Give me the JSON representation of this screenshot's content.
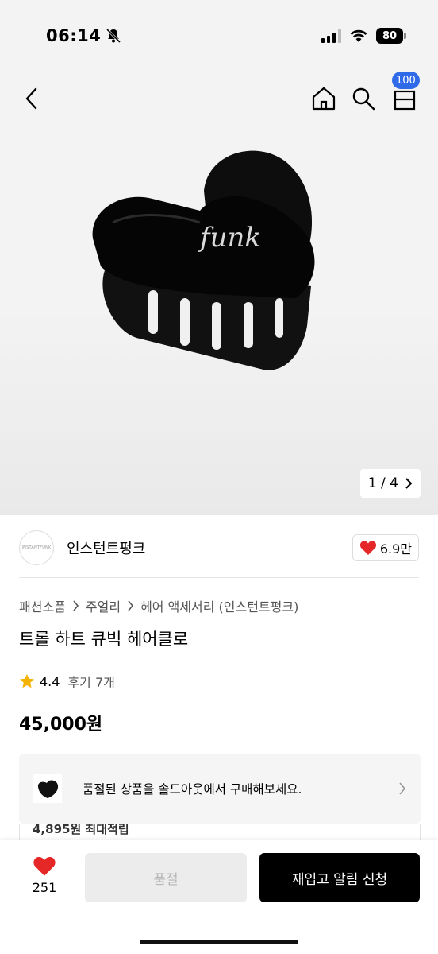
{
  "status_bar": {
    "time": "06:14",
    "battery": "80"
  },
  "nav": {
    "cart_count": "100"
  },
  "image": {
    "page": "1 / 4",
    "engraving": "funk"
  },
  "brand": {
    "name": "인스턴트펑크",
    "logo_text": "INSTANTFUNK",
    "likes": "6.9만"
  },
  "breadcrumb": [
    "패션소품",
    "주얼리",
    "헤어 액세서리 (인스턴트펑크)"
  ],
  "product": {
    "title": "트롤 하트 큐빅 헤어클로",
    "rating": "4.4",
    "review_link": "후기 7개",
    "price": "45,000원"
  },
  "soldout_banner": {
    "text": "품절된 상품을 솔드아웃에서 구매해보세요."
  },
  "points_peek": "4,895원 최대적립",
  "bottom_bar": {
    "like_count": "251",
    "soldout_label": "품절",
    "restock_label": "재입고 알림 신청"
  },
  "colors": {
    "badge_blue": "#2f6ae8",
    "heart_red": "#e62727",
    "star_yellow": "#f5b301",
    "cta_black": "#000000"
  }
}
